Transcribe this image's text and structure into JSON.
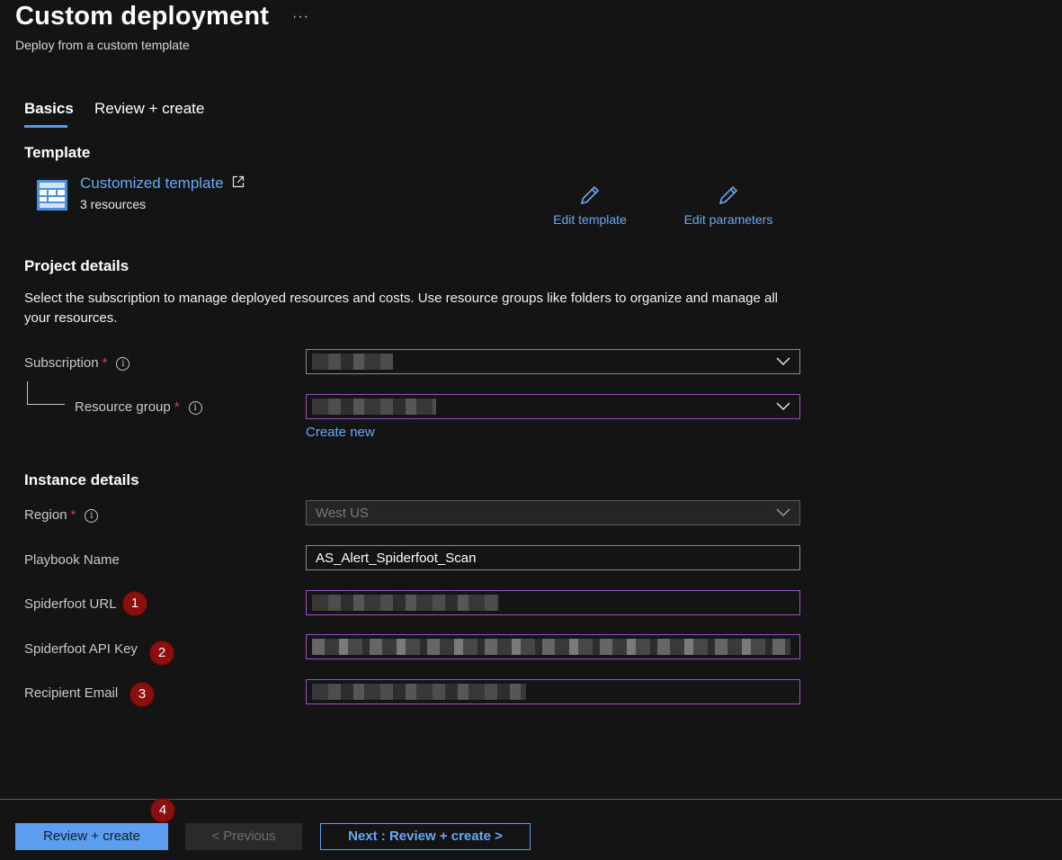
{
  "header": {
    "title": "Custom deployment",
    "more_label": "···",
    "subtitle": "Deploy from a custom template"
  },
  "tabs": [
    {
      "label": "Basics",
      "active": true
    },
    {
      "label": "Review + create",
      "active": false
    }
  ],
  "template": {
    "heading": "Template",
    "name": "Customized template",
    "resources": "3 resources",
    "edit_template": "Edit template",
    "edit_parameters": "Edit parameters"
  },
  "project": {
    "heading": "Project details",
    "description": "Select the subscription to manage deployed resources and costs. Use resource groups like folders to organize and manage all your resources.",
    "subscription_label": "Subscription",
    "resource_group_label": "Resource group",
    "required_mark": "*",
    "info_mark": "i",
    "create_new": "Create new"
  },
  "instance": {
    "heading": "Instance details",
    "region_label": "Region",
    "region_value": "West US",
    "playbook_label": "Playbook Name",
    "playbook_value": "AS_Alert_Spiderfoot_Scan",
    "url_label": "Spiderfoot URL",
    "api_key_label": "Spiderfoot API Key",
    "email_label": "Recipient Email"
  },
  "badges": [
    "1",
    "2",
    "3",
    "4"
  ],
  "footer": {
    "review_create": "Review + create",
    "previous": "< Previous",
    "next": "Next : Review + create >"
  },
  "colors": {
    "background": "#141414",
    "accent": "#5c9ef0",
    "link": "#6aa7f5",
    "required": "#e0404a",
    "badge": "#8b0f0f",
    "focus_border": "#9450c8"
  }
}
